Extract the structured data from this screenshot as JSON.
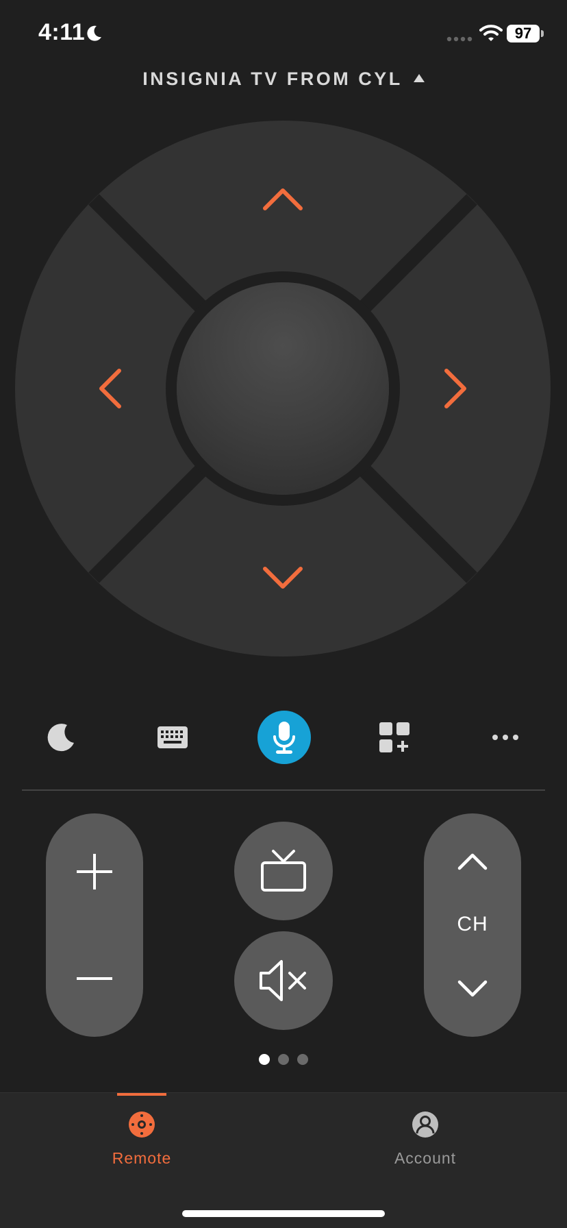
{
  "status_bar": {
    "time": "4:11",
    "battery": "97"
  },
  "device": {
    "name": "INSIGNIA TV FROM CYL"
  },
  "colors": {
    "accent": "#f26d3d",
    "mic": "#17a2d6",
    "button": "#5a5a5a",
    "dpad": "#333333"
  },
  "shortcuts": [
    {
      "icon": "sleep-moon-icon"
    },
    {
      "icon": "keyboard-icon"
    },
    {
      "icon": "microphone-icon"
    },
    {
      "icon": "apps-add-icon"
    },
    {
      "icon": "more-icon"
    }
  ],
  "controls": {
    "ch_label": "CH"
  },
  "pager": {
    "pages": 3,
    "active": 1
  },
  "tabs": [
    {
      "label": "Remote",
      "icon": "remote-icon",
      "active": true
    },
    {
      "label": "Account",
      "icon": "account-icon",
      "active": false
    }
  ]
}
